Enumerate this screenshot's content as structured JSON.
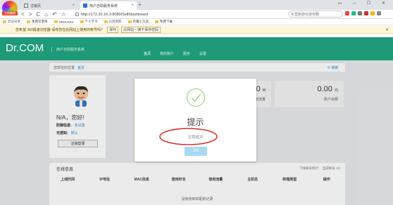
{
  "browser": {
    "logo_label": "立即编辑",
    "tabs": [
      {
        "title": "注销页"
      },
      {
        "title": "用户自助服务系统"
      }
    ],
    "new_tab": "+",
    "window_controls": "▭ ─ ☐ ✕",
    "nav": {
      "back": "<",
      "forward": ">",
      "reload": "C",
      "home": "⌂",
      "undo": "↶",
      "star": "☆"
    },
    "url": "http://172.20.16.3:8080/Self/dashboard",
    "search_placeholder": "东营旅游出游攻略",
    "bookmarks": [
      "云记分享",
      "免费云游戏",
      "ONVUOUI",
      "个人学习",
      "公司资料",
      "有趣小工具",
      "免费下载"
    ],
    "password_bar": {
      "message": "您希望 360极速浏览器 保存您在此网站上使用的帐号吗？",
      "save": "保存",
      "never": "此网站一律不保存密码",
      "close": "✕"
    }
  },
  "app": {
    "brand": "Dr.COM",
    "subtitle": "用户自助服务系统",
    "nav": [
      "首页",
      "我的账户",
      "服务",
      "设置"
    ],
    "breadcrumb": {
      "prefix": "您现在的位置",
      "home": "首页"
    },
    "refresh": "⟳ 刷新",
    "profile": {
      "greeting": "N/A，您好!",
      "rows": [
        {
          "label": "防御信息:",
          "value": "未设置"
        },
        {
          "label": "无感知:",
          "value": "默认"
        }
      ],
      "logout": "注销登录"
    },
    "stats": [
      {
        "value": "0",
        "unit": "M",
        "label": "使用流量"
      },
      {
        "value": "0.00",
        "unit": "元",
        "label": "账户余额"
      }
    ],
    "online": {
      "title": "在线信息",
      "right": "下线帐号统计：  当前帐号 1/1",
      "columns": [
        "上线时间",
        "IP地址",
        "MAC信息",
        "使用时长",
        "使用流量",
        "主机名",
        "终端类型",
        "操作"
      ],
      "empty": "没有找到匹配的记录"
    }
  },
  "modal": {
    "title": "提示",
    "message": "注销成功",
    "ok": "OK"
  },
  "colors": {
    "header": "#1e9a78",
    "accent": "#2d8fd8",
    "annotation_ring": "#d9302a",
    "ok_button": "#a8d8f4"
  }
}
